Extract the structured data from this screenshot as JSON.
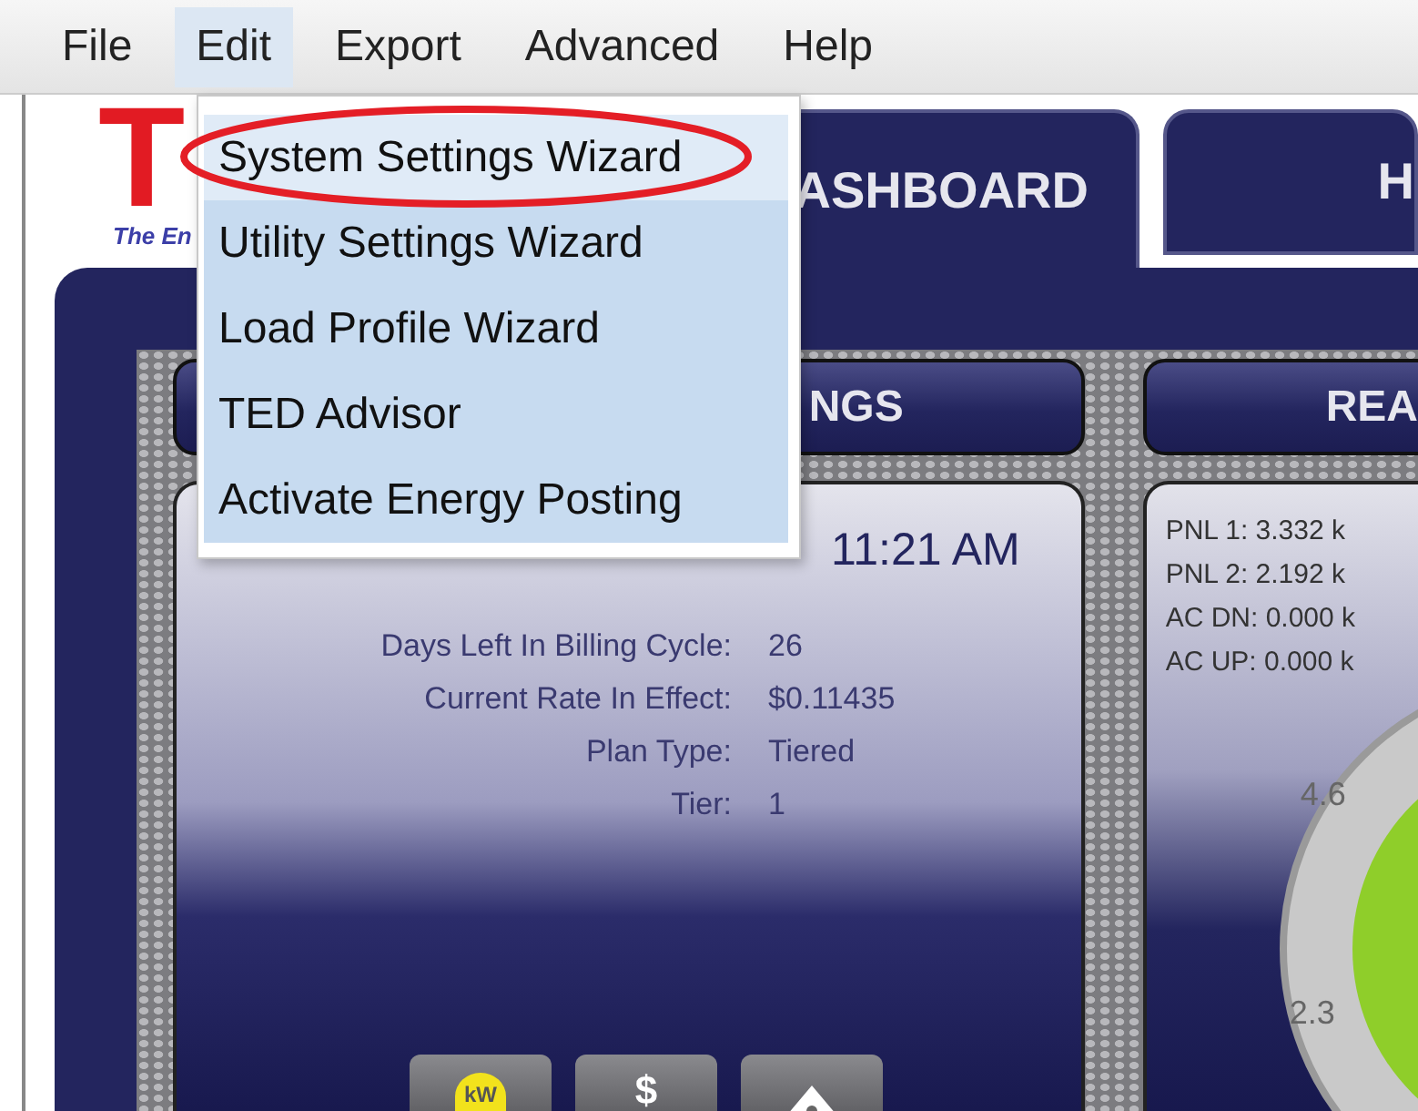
{
  "menu_bar": [
    {
      "label": "File",
      "selected": false
    },
    {
      "label": "Edit",
      "selected": true
    },
    {
      "label": "Export",
      "selected": false
    },
    {
      "label": "Advanced",
      "selected": false
    },
    {
      "label": "Help",
      "selected": false
    }
  ],
  "edit_menu": {
    "items": [
      {
        "label": "System Settings Wizard",
        "selected": true
      },
      {
        "label": "Utility Settings Wizard",
        "selected": false
      },
      {
        "label": "Load Profile Wizard",
        "selected": false
      },
      {
        "label": "TED Advisor",
        "selected": false
      },
      {
        "label": "Activate Energy Posting",
        "selected": false
      }
    ]
  },
  "logo": {
    "mark": "T",
    "tagline": "The En"
  },
  "tabs": [
    {
      "label": "ASHBOARD",
      "selected": true
    },
    {
      "label": "H",
      "selected": false
    }
  ],
  "sections": [
    {
      "header": "NGS"
    },
    {
      "header": "REA"
    }
  ],
  "billing_card": {
    "time": "11:21 AM",
    "rows": [
      {
        "label": "Days Left In Billing Cycle:",
        "value": "26"
      },
      {
        "label": "Current Rate In Effect:",
        "value": "$0.11435"
      },
      {
        "label": "Plan Type:",
        "value": "Tiered"
      },
      {
        "label": "Tier:",
        "value": "1"
      }
    ],
    "buttons": [
      {
        "kind": "kw",
        "label": "kW"
      },
      {
        "kind": "dollar",
        "label": "$"
      },
      {
        "kind": "home"
      }
    ]
  },
  "readings_card": {
    "lines": [
      "PNL 1: 3.332 k",
      "PNL 2: 2.192 k",
      "AC DN: 0.000 k",
      "AC UP: 0.000 k"
    ],
    "gauge_labels": [
      "4.6",
      "2.3"
    ]
  }
}
